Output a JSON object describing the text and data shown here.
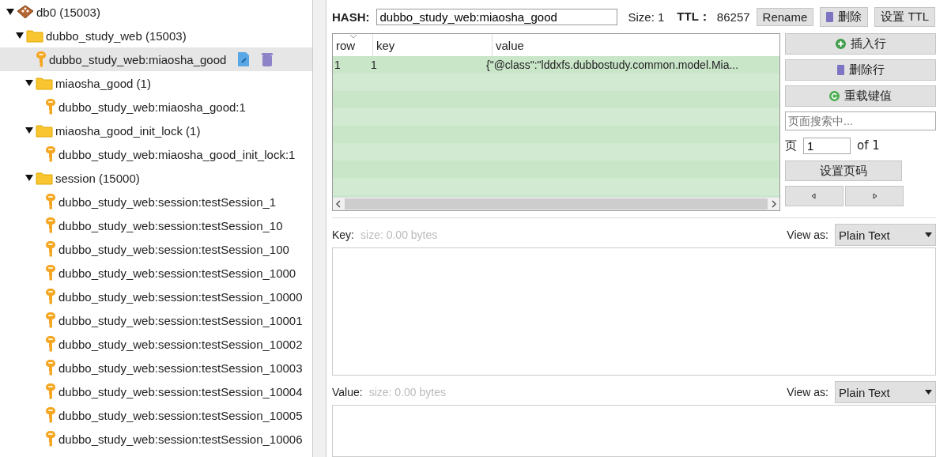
{
  "tree": [
    {
      "label": "db0  (15003)",
      "kind": "database",
      "expanded": true,
      "selected": false,
      "children": [
        {
          "label": "dubbo_study_web (15003)",
          "kind": "folder",
          "expanded": true,
          "selected": false,
          "children": [
            {
              "label": "dubbo_study_web:miaosha_good",
              "kind": "key",
              "selected": true
            },
            {
              "label": "miaosha_good (1)",
              "kind": "folder",
              "expanded": true,
              "selected": false,
              "children": [
                {
                  "label": "dubbo_study_web:miaosha_good:1",
                  "kind": "key",
                  "selected": false
                }
              ]
            },
            {
              "label": "miaosha_good_init_lock (1)",
              "kind": "folder",
              "expanded": true,
              "selected": false,
              "children": [
                {
                  "label": "dubbo_study_web:miaosha_good_init_lock:1",
                  "kind": "key",
                  "selected": false
                }
              ]
            },
            {
              "label": "session (15000)",
              "kind": "folder",
              "expanded": true,
              "selected": false,
              "children": [
                {
                  "label": "dubbo_study_web:session:testSession_1",
                  "kind": "key",
                  "selected": false
                },
                {
                  "label": "dubbo_study_web:session:testSession_10",
                  "kind": "key",
                  "selected": false
                },
                {
                  "label": "dubbo_study_web:session:testSession_100",
                  "kind": "key",
                  "selected": false
                },
                {
                  "label": "dubbo_study_web:session:testSession_1000",
                  "kind": "key",
                  "selected": false
                },
                {
                  "label": "dubbo_study_web:session:testSession_10000",
                  "kind": "key",
                  "selected": false
                },
                {
                  "label": "dubbo_study_web:session:testSession_10001",
                  "kind": "key",
                  "selected": false
                },
                {
                  "label": "dubbo_study_web:session:testSession_10002",
                  "kind": "key",
                  "selected": false
                },
                {
                  "label": "dubbo_study_web:session:testSession_10003",
                  "kind": "key",
                  "selected": false
                },
                {
                  "label": "dubbo_study_web:session:testSession_10004",
                  "kind": "key",
                  "selected": false
                },
                {
                  "label": "dubbo_study_web:session:testSession_10005",
                  "kind": "key",
                  "selected": false
                },
                {
                  "label": "dubbo_study_web:session:testSession_10006",
                  "kind": "key",
                  "selected": false
                }
              ]
            }
          ]
        }
      ]
    }
  ],
  "header": {
    "type_label": "HASH:",
    "key_name": "dubbo_study_web:miaosha_good",
    "size": "Size: 1",
    "ttl_label": "TTL：",
    "ttl_value": "86257",
    "buttons": [
      {
        "label": "Rename",
        "kind": "plain"
      },
      {
        "label": "删除",
        "kind": "trash"
      },
      {
        "label": "设置 TTL",
        "kind": "plain"
      }
    ]
  },
  "table": {
    "columns": [
      "row",
      "key",
      "value"
    ],
    "rows": [
      {
        "row": "1",
        "key": "1",
        "value": "{\"@class\":\"lddxfs.dubbostudy.common.model.Mia..."
      }
    ]
  },
  "actions": [
    {
      "label": "插入行",
      "kind": "plus"
    },
    {
      "label": "删除行",
      "kind": "trash"
    },
    {
      "label": "重载键值",
      "kind": "reload"
    }
  ],
  "search": {
    "placeholder": "页面搜索中..."
  },
  "pager": {
    "label": "页",
    "page": "1",
    "of": "of 1",
    "button": "设置页码"
  },
  "editors": [
    {
      "label": "Key:",
      "size": "size: 0.00 bytes",
      "view_as": "View as:",
      "format": "Plain Text"
    },
    {
      "label": "Value:",
      "size": "size: 0.00 bytes",
      "view_as": "View as:",
      "format": "Plain Text"
    }
  ]
}
